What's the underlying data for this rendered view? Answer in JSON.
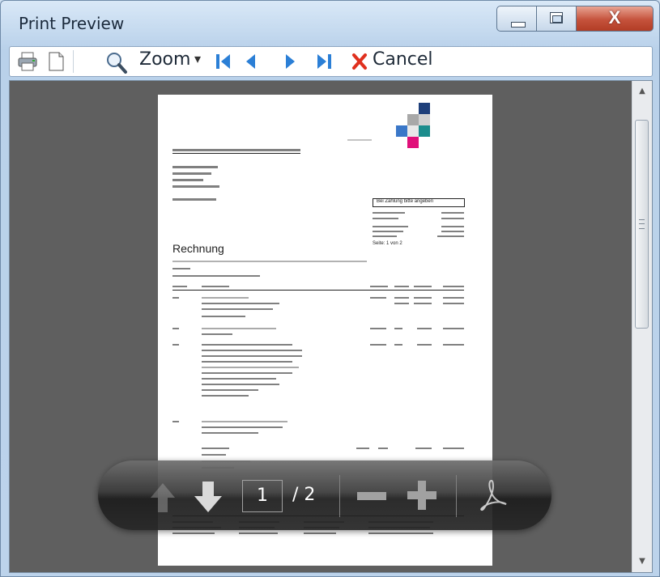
{
  "window": {
    "title": "Print Preview"
  },
  "toolbar": {
    "zoom_label": "Zoom",
    "cancel_label": "Cancel"
  },
  "document": {
    "heading": "Rechnung",
    "info_box_title": "Bei Zahlung bitte angeben",
    "page_indicator": "Seite: 1 von 2"
  },
  "overlay": {
    "current_page": "1",
    "total_pages": "/ 2"
  }
}
